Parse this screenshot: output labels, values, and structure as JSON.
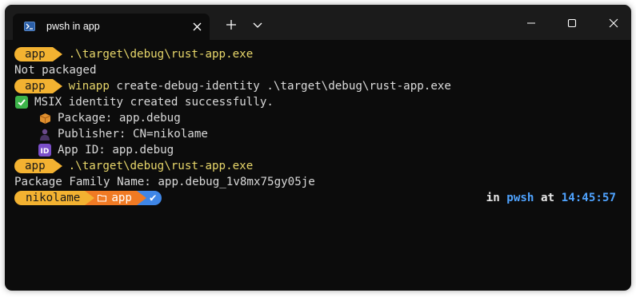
{
  "window": {
    "tab_title": "pwsh in app",
    "tab_icon": "powershell-icon",
    "controls": [
      "minimize-icon",
      "maximize-icon",
      "close-icon"
    ]
  },
  "terminal": {
    "lines": [
      {
        "kind": "prompt",
        "segment": "app",
        "command": ".\\target\\debug\\rust-app.exe"
      },
      {
        "kind": "output",
        "text": "Not packaged"
      },
      {
        "kind": "prompt",
        "segment": "app",
        "command_program": "winapp",
        "command_args": " create-debug-identity .\\target\\debug\\rust-app.exe"
      },
      {
        "kind": "output",
        "icon": "check-mark-icon",
        "text": "MSIX identity created successfully."
      },
      {
        "kind": "output",
        "icon": "package-icon",
        "text": "Package: app.debug"
      },
      {
        "kind": "output",
        "icon": "person-icon",
        "text": "Publisher: CN=nikolame"
      },
      {
        "kind": "output",
        "icon": "id-icon",
        "text": "App ID: app.debug"
      },
      {
        "kind": "prompt",
        "segment": "app",
        "command": ".\\target\\debug\\rust-app.exe"
      },
      {
        "kind": "output",
        "text": "Package Family Name: app.debug_1v8mx75gy05je"
      }
    ],
    "final_prompt": {
      "user": "nikolame",
      "dir": "app",
      "git": "✔",
      "right_in": "in",
      "right_shell": "pwsh",
      "right_at": "at",
      "right_time": "14:45:57"
    }
  },
  "colors": {
    "segment_yellow": "#f3b231",
    "segment_orange": "#f07a24",
    "segment_blue": "#3f86e6",
    "command_yellow": "#e7d66a",
    "background": "#0c0c0c"
  }
}
